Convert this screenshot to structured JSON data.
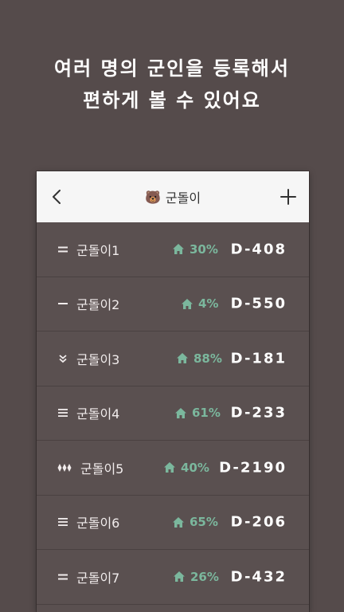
{
  "headline": {
    "line1": "여러 명의 군인을 등록해서",
    "line2": "편하게 볼 수 있어요"
  },
  "appbar": {
    "title": "군돌이",
    "title_icon": "bear-face-icon"
  },
  "colors": {
    "background": "#554b4b",
    "appbar": "#f6f6f6",
    "accent_green": "#7bb79d",
    "text_white": "#ffffff"
  },
  "soldiers": [
    {
      "name": "군돌이1",
      "percent": "30%",
      "dday": "D-408",
      "handle_icon": "double-line-icon"
    },
    {
      "name": "군돌이2",
      "percent": "4%",
      "dday": "D-550",
      "handle_icon": "single-line-icon"
    },
    {
      "name": "군돌이3",
      "percent": "88%",
      "dday": "D-181",
      "handle_icon": "double-chevron-icon"
    },
    {
      "name": "군돌이4",
      "percent": "61%",
      "dday": "D-233",
      "handle_icon": "triple-line-icon"
    },
    {
      "name": "군돌이5",
      "percent": "40%",
      "dday": "D-2190",
      "handle_icon": "diamond-rank-icon"
    },
    {
      "name": "군돌이6",
      "percent": "65%",
      "dday": "D-206",
      "handle_icon": "triple-line-icon"
    },
    {
      "name": "군돌이7",
      "percent": "26%",
      "dday": "D-432",
      "handle_icon": "double-line-icon"
    }
  ]
}
